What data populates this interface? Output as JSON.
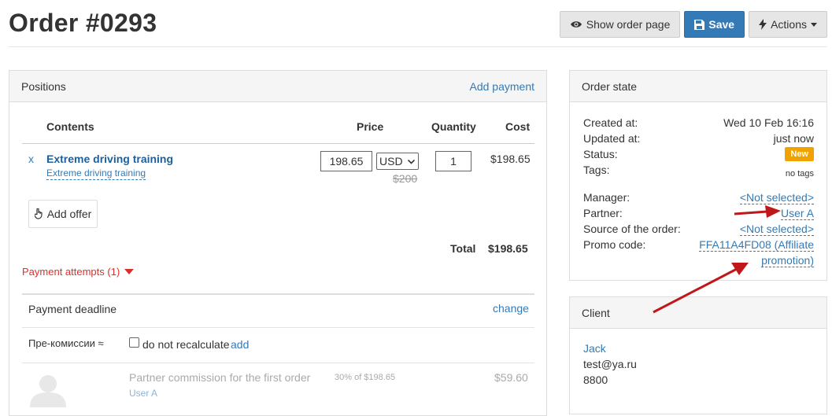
{
  "header": {
    "title": "Order #0293",
    "show_order_page": "Show order page",
    "save": "Save",
    "actions": "Actions"
  },
  "positions": {
    "title": "Positions",
    "add_payment": "Add payment",
    "columns": {
      "contents": "Contents",
      "price": "Price",
      "quantity": "Quantity",
      "cost": "Cost"
    },
    "items": [
      {
        "remove": "x",
        "name": "Extreme driving training",
        "subname": "Extreme driving training",
        "price": "198.65",
        "currency": "USD",
        "old_price": "$200",
        "quantity": "1",
        "cost": "$198.65"
      }
    ],
    "add_offer": "Add offer",
    "total_label": "Total",
    "total_value": "$198.65",
    "payment_attempts": "Payment attempts (1)",
    "deadline_label": "Payment deadline",
    "deadline_change": "change",
    "precommission_label": "Пре-комиссии ≈",
    "do_not_recalculate": "do not recalculate",
    "add": "add",
    "commission": {
      "title": "Partner commission for the first order",
      "user": "User A",
      "percent": "30% of $198.65",
      "value": "$59.60"
    }
  },
  "order_state": {
    "title": "Order state",
    "created_label": "Created at:",
    "created_value": "Wed 10 Feb 16:16",
    "updated_label": "Updated at:",
    "updated_value": "just now",
    "status_label": "Status:",
    "status_value": "New",
    "tags_label": "Tags:",
    "tags_value": "no tags",
    "manager_label": "Manager:",
    "manager_value": "<Not selected>",
    "partner_label": "Partner:",
    "partner_value": "User A",
    "source_label": "Source of the order:",
    "source_value": "<Not selected>",
    "promo_label": "Promo code:",
    "promo_line1": "FFA11A4FD08 (Affiliate",
    "promo_line2": "promotion)"
  },
  "client": {
    "title": "Client",
    "name": "Jack",
    "email": "test@ya.ru",
    "phone": "8800"
  },
  "colors": {
    "primary": "#337ab7",
    "status_new": "#f0a300",
    "alert": "#d9302c",
    "annotation_arrow": "#c0171b"
  }
}
